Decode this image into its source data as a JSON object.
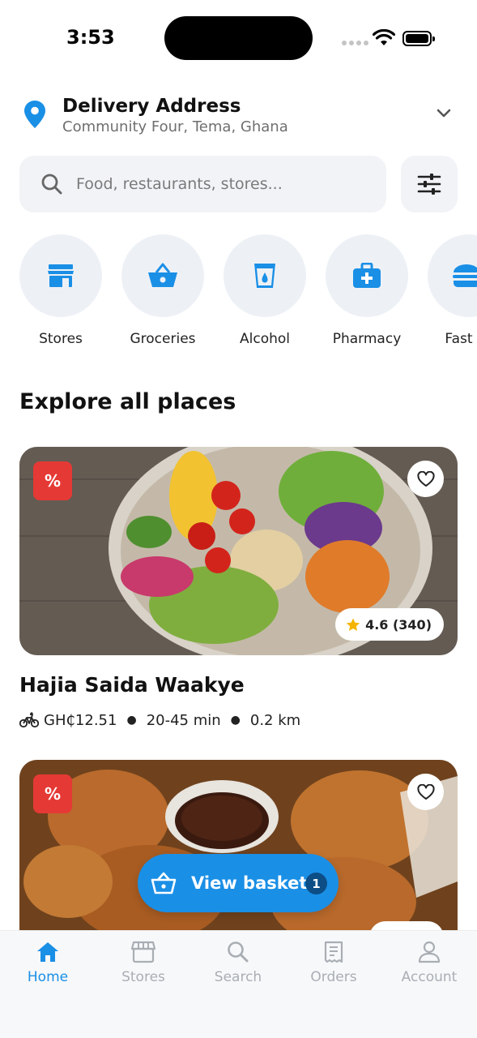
{
  "status_bar": {
    "time": "3:53"
  },
  "delivery": {
    "title": "Delivery Address",
    "address": "Community Four, Tema, Ghana"
  },
  "search": {
    "placeholder": "Food, restaurants, stores..."
  },
  "categories": [
    {
      "label": "Stores",
      "icon": "storefront-icon"
    },
    {
      "label": "Groceries",
      "icon": "basket-icon"
    },
    {
      "label": "Alcohol",
      "icon": "glass-icon"
    },
    {
      "label": "Pharmacy",
      "icon": "medical-bag-icon"
    },
    {
      "label": "Fast Fo",
      "icon": "burger-icon"
    }
  ],
  "section_title": "Explore all places",
  "places": [
    {
      "name": "Hajia Saida Waakye",
      "promo": "%",
      "rating": "4.6 (340)",
      "delivery_fee": "GH₵12.51",
      "time": "20-45 min",
      "distance": "0.2 km"
    },
    {
      "promo": "%"
    }
  ],
  "basket": {
    "label": "View basket",
    "count": "1"
  },
  "tabs": [
    {
      "label": "Home",
      "icon": "home-icon",
      "active": true
    },
    {
      "label": "Stores",
      "icon": "store-icon",
      "active": false
    },
    {
      "label": "Search",
      "icon": "search-icon",
      "active": false
    },
    {
      "label": "Orders",
      "icon": "receipt-icon",
      "active": false
    },
    {
      "label": "Account",
      "icon": "user-icon",
      "active": false
    }
  ],
  "colors": {
    "accent": "#1a8fe6",
    "promo": "#e53935",
    "star": "#f5b400",
    "tab_inactive": "#a9aeb4"
  }
}
